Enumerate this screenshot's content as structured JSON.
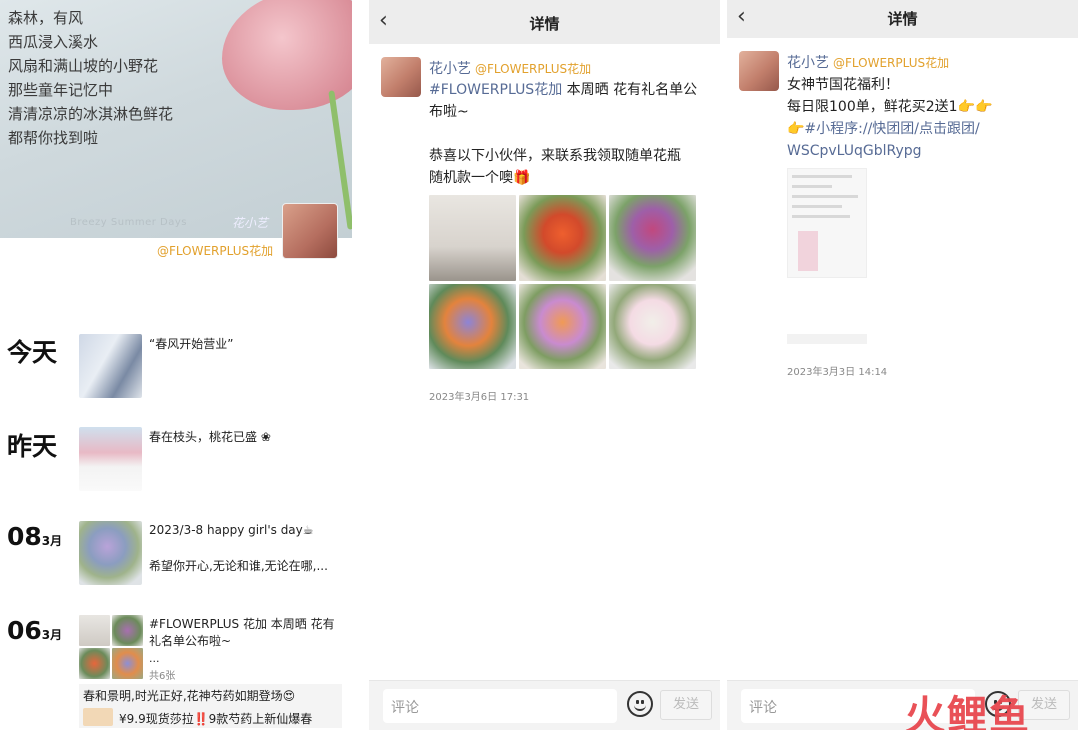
{
  "album": {
    "poem": [
      "森林，有风",
      "西瓜浸入溪水",
      "风扇和满山坡的小野花",
      "那些童年记忆中",
      "清清凉凉的冰淇淋色鲜花",
      "都帮你找到啦"
    ],
    "cover_caption": "Breezy Summer Days",
    "cover_signature": "花小艺",
    "handle": "@FLOWERPLUS花加",
    "entries": [
      {
        "day": "今天",
        "text": "“春风开始营业”"
      },
      {
        "day": "昨天",
        "text": "春在枝头，桃花已盛 ❀"
      },
      {
        "day": "08",
        "month": "3月",
        "line1": "2023/3-8 happy girl's day☕",
        "line2": "希望你开心,无论和谁,无论在哪,..."
      },
      {
        "day": "06",
        "month": "3月",
        "line1": "#FLOWERPLUS 花加 本周晒 花有",
        "line2": "礼名单公布啦~",
        "line3": "...",
        "count": "共6张"
      }
    ],
    "promo": {
      "line1": "春和景明,时光正好,花神芍药如期登场😍",
      "line2": "¥9.9现货莎拉‼️9款芍药上新仙爆春"
    }
  },
  "detail1": {
    "title": "详情",
    "user": "花小艺",
    "handle": "@FLOWERPLUS花加",
    "lines": [
      "#FLOWERPLUS花加 本周晒 花有礼名单公",
      "布啦~",
      "",
      "恭喜以下小伙伴，来联系我领取随单花瓶",
      "随机款一个噢🎁"
    ],
    "timestamp": "2023年3月6日 17:31",
    "comment_placeholder": "评论",
    "send_label": "发送"
  },
  "detail2": {
    "title": "详情",
    "user": "花小艺",
    "handle": "@FLOWERPLUS花加",
    "lines": [
      "女神节国花福利！",
      "每日限100单，鲜花买2送1👉👉",
      "👉#小程序://快团团/点击跟团/",
      "WSCpvLUqGblRypg"
    ],
    "timestamp": "2023年3月3日 14:14",
    "comment_placeholder": "评论",
    "send_label": "发送"
  },
  "watermark": "火鲤鱼",
  "colors": {
    "link": "#576b95",
    "handle": "#e2a12d",
    "topbar": "#ededed"
  }
}
